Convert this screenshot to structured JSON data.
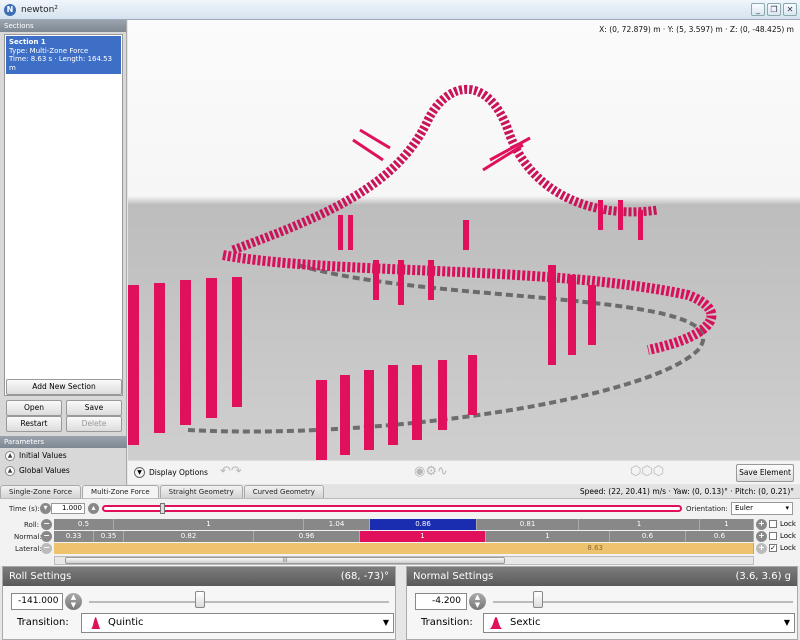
{
  "window": {
    "title": "newton²",
    "app_icon": "N"
  },
  "sidebar": {
    "sections_header": "Sections",
    "sections": [
      {
        "name": "Section 1",
        "type": "Type: Multi-Zone Force",
        "time": "Time: 8.63 s · Length: 164.53 m"
      }
    ],
    "buttons": {
      "add": "Add New Section",
      "open": "Open",
      "save": "Save",
      "restart": "Restart",
      "delete": "Delete"
    },
    "parameters_header": "Parameters",
    "parameters": [
      "Initial Values",
      "Global Values"
    ]
  },
  "viewport": {
    "coords": {
      "x": "X: (0, 72.879) m",
      "y": "Y: (5, 3.597) m",
      "z": "Z: (0, -48.425) m"
    },
    "display_options": "Display Options",
    "save_element": "Save Element"
  },
  "tabs": [
    {
      "label": "Single-Zone Force",
      "active": false
    },
    {
      "label": "Multi-Zone Force",
      "active": true
    },
    {
      "label": "Straight Geometry",
      "active": false
    },
    {
      "label": "Curved Geometry",
      "active": false
    }
  ],
  "status": {
    "text": "Speed: (22, 20.41) m/s · Yaw: (0, 0.13)° · Pitch: (0, 0.21)°"
  },
  "editor": {
    "time_label": "Time (s):",
    "time_value": "1.000",
    "orientation_label": "Orientation:",
    "orientation_value": "Euler",
    "roll_label": "Roll:",
    "normal_label": "Normal:",
    "lateral_label": "Lateral:",
    "lock_label": "Lock",
    "roll_cells": [
      "0.5",
      "1",
      "1.04",
      "0.86",
      "0.81",
      "1",
      "1"
    ],
    "normal_cells": [
      "0.33",
      "0.35",
      "0.82",
      "0.96",
      "1",
      "1",
      "0.6",
      "0.6"
    ],
    "lateral_value": "8.63",
    "scroll_thumb": "III"
  },
  "roll_panel": {
    "title": "Roll Settings",
    "range": "(68, -73)°",
    "value": "-141.000",
    "transition_label": "Transition:",
    "transition": "Quintic",
    "slider_fraction": 0.37
  },
  "normal_panel": {
    "title": "Normal Settings",
    "range": "(3.6, 3.6) g",
    "value": "-4.200",
    "transition_label": "Transition:",
    "transition": "Sextic",
    "slider_fraction": 0.15
  },
  "colors": {
    "track": "#e0105c",
    "selection_blue": "#1a2cb0",
    "lateral": "#efc36d"
  }
}
